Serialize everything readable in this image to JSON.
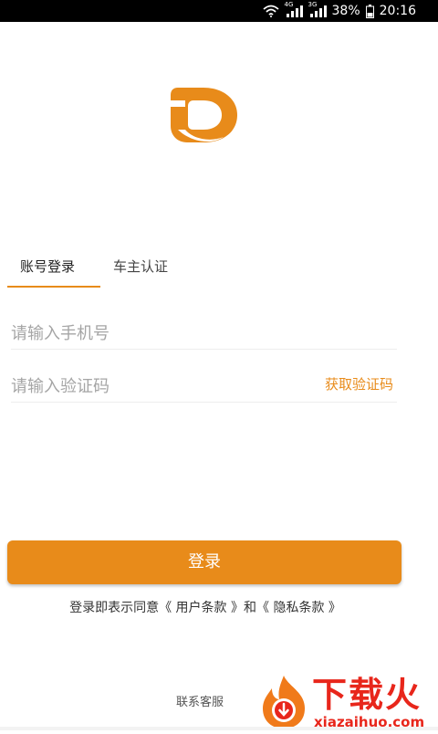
{
  "status_bar": {
    "network_4g": "4G",
    "network_3g": "3G",
    "battery": "38%",
    "time": "20:16"
  },
  "tabs": [
    {
      "label": "账号登录",
      "active": true
    },
    {
      "label": "车主认证",
      "active": false
    }
  ],
  "form": {
    "phone_placeholder": "请输入手机号",
    "code_placeholder": "请输入验证码",
    "get_code_label": "获取验证码"
  },
  "login_button": "登录",
  "agreement": {
    "prefix": "登录即表示同意",
    "user_terms": "《 用户条款 》",
    "and": "和",
    "privacy_terms": "《 隐私条款 》"
  },
  "contact_label": "联系客服",
  "watermark": {
    "title": "下载火",
    "site": "xiazaihuo.com"
  },
  "colors": {
    "accent": "#e88b1a",
    "watermark": "#e8261b"
  }
}
